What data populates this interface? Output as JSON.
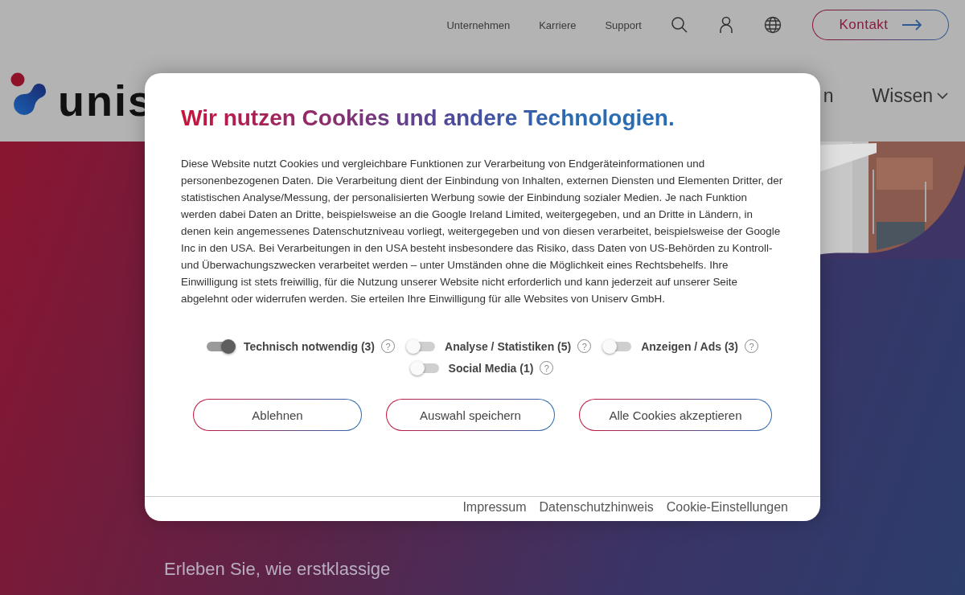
{
  "header": {
    "logo_text": "unis",
    "top_links": [
      "Unternehmen",
      "Karriere",
      "Support"
    ],
    "contact_button": {
      "label": "Kontakt"
    },
    "main_nav": [
      {
        "label": "n",
        "dropdown": false
      },
      {
        "label": "Wissen",
        "dropdown": true
      }
    ]
  },
  "hero": {
    "subline": "Erleben Sie, wie erstklassige"
  },
  "cookie_dialog": {
    "title": "Wir nutzen Cookies und andere Technologien.",
    "body": "Diese Website nutzt Cookies und vergleichbare Funktionen zur Verarbeitung von Endgeräteinformationen und personenbezogenen Daten. Die Verarbeitung dient der Einbindung von Inhalten, externen Diensten und Elementen Dritter, der statistischen Analyse/Messung, der personalisierten Werbung sowie der Einbindung sozialer Medien. Je nach Funktion werden dabei Daten an Dritte, beispielsweise an die Google Ireland Limited, weitergegeben, und an Dritte in Ländern, in denen kein angemessenes Datenschutzniveau vorliegt, weitergegeben und von diesen verarbeitet, beispielsweise der Google Inc in den USA. Bei Verarbeitungen in den USA besteht insbesondere das Risiko, dass Daten von US-Behörden zu Kontroll- und Überwachungszwecken verarbeitet werden – unter Umständen ohne die Möglichkeit eines Rechtsbehelfs. Ihre Einwilligung ist stets freiwillig, für die Nutzung unserer Website nicht erforderlich und kann jederzeit auf unserer Seite abgelehnt oder widerrufen werden. Sie erteilen Ihre Einwilligung für alle Websites von Uniserv GmbH.",
    "categories": [
      {
        "label": "Technisch notwendig (3)",
        "on": true,
        "help": "?"
      },
      {
        "label": "Analyse / Statistiken (5)",
        "on": false,
        "help": "?"
      },
      {
        "label": "Anzeigen / Ads (3)",
        "on": false,
        "help": "?"
      },
      {
        "label": "Social Media (1)",
        "on": false,
        "help": "?"
      }
    ],
    "buttons": [
      "Ablehnen",
      "Auswahl speichern",
      "Alle Cookies akzeptieren"
    ],
    "footer_links": [
      "Impressum",
      "Datenschutzhinweis",
      "Cookie-Einstellungen"
    ]
  }
}
